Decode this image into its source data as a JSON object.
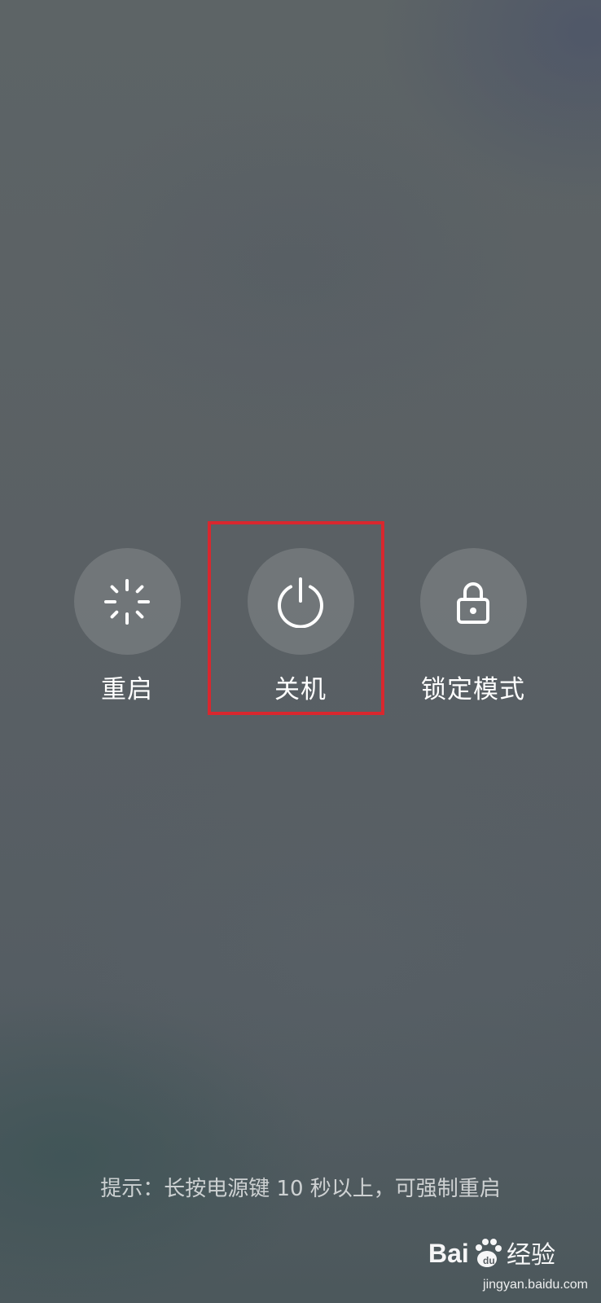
{
  "power_menu": {
    "actions": [
      {
        "label": "重启",
        "icon": "restart-icon"
      },
      {
        "label": "关机",
        "icon": "power-icon"
      },
      {
        "label": "锁定模式",
        "icon": "lock-icon"
      }
    ],
    "hint": "提示：长按电源键 10 秒以上，可强制重启"
  },
  "highlight": {
    "color": "#d9272e"
  },
  "watermark": {
    "brand": "Bai du 经验",
    "url": "jingyan.baidu.com"
  }
}
